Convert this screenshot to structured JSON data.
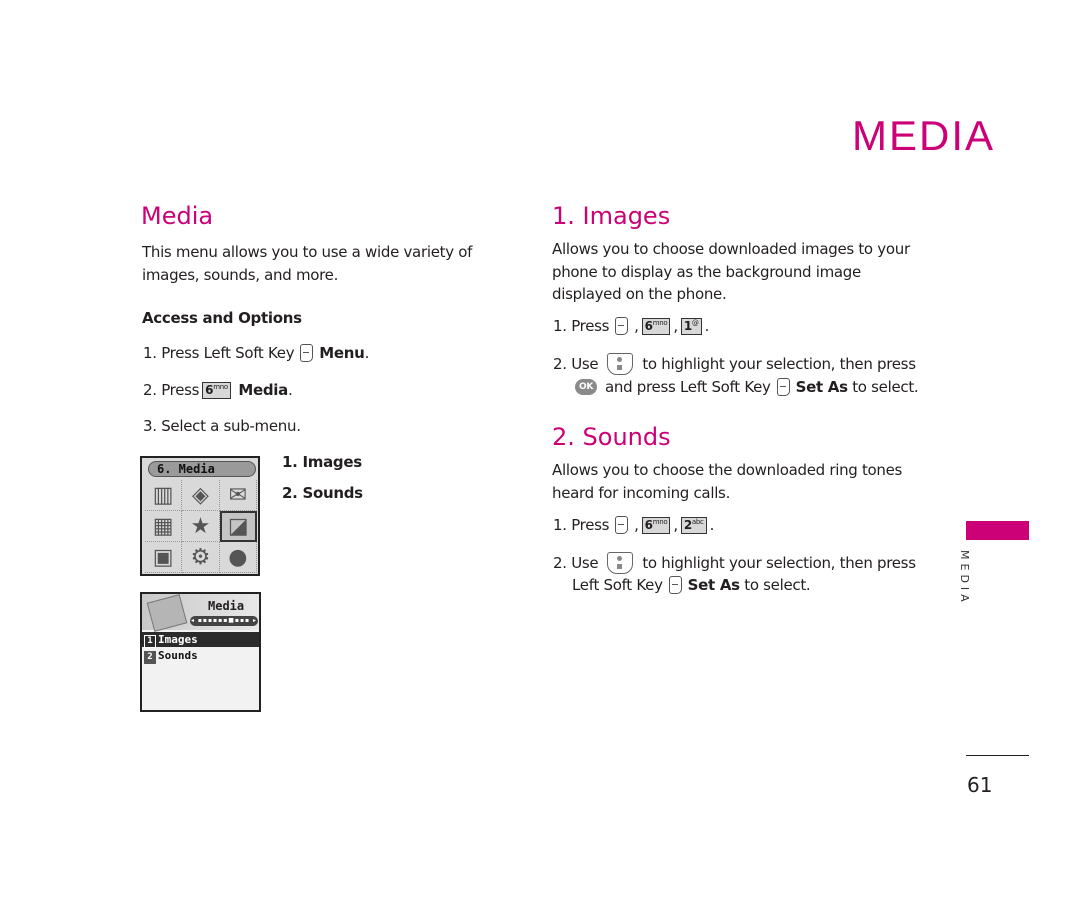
{
  "chapter_title": "MEDIA",
  "left": {
    "heading": "Media",
    "intro": "This menu allows you to use a wide variety of images, sounds, and more.",
    "subheading": "Access and Options",
    "steps": [
      {
        "num": "1.",
        "text": "Press Left Soft Key",
        "icon": "left-soft-key-icon",
        "bold": "Menu",
        "end": "."
      },
      {
        "num": "2.",
        "text": "Press",
        "icon": "key-6-mno",
        "bold": "Media",
        "end": "."
      },
      {
        "num": "3.",
        "text": "Select a sub-menu."
      }
    ],
    "submenu": [
      "1. Images",
      "2. Sounds"
    ],
    "phone_screen_1": {
      "title": "6. Media",
      "icons": [
        "address-book-icon",
        "calendar-icon",
        "messages-icon",
        "phone-icon",
        "star-icon",
        "media-icon",
        "toolbox-icon",
        "settings-gears-icon",
        "mouse-icon"
      ]
    },
    "phone_screen_2": {
      "title": "Media",
      "scroll_indicator": "◂ ▪▪▪▪▪▪■▪▪▪ ▸",
      "items": [
        {
          "num": "1",
          "label": "Images",
          "highlighted": true
        },
        {
          "num": "2",
          "label": "Sounds",
          "highlighted": false
        }
      ]
    }
  },
  "right": {
    "images": {
      "heading": "1. Images",
      "desc": "Allows you to choose downloaded images to your phone to display as the background image displayed on the phone.",
      "step1": {
        "num": "1.",
        "text": "Press",
        "keys": [
          "left-soft-key",
          "6mno",
          "1"
        ],
        "end": "."
      },
      "step2": {
        "num": "2.",
        "use": "Use",
        "after_nav": "to highlight your selection, then press",
        "ok": "OK",
        "line2a": "and press Left Soft Key",
        "bold": "Set As",
        "line2b": "to select."
      }
    },
    "sounds": {
      "heading": "2. Sounds",
      "desc": "Allows you to choose the downloaded ring tones heard for incoming calls.",
      "step1": {
        "num": "1.",
        "text": "Press",
        "keys": [
          "left-soft-key",
          "6mno",
          "2abc"
        ],
        "end": "."
      },
      "step2": {
        "num": "2.",
        "use": "Use",
        "after_nav": "to highlight your selection, then press",
        "line2a": "Left Soft Key",
        "bold": "Set As",
        "line2b": "to select."
      }
    }
  },
  "key_labels": {
    "six": "6",
    "six_sup": "mno",
    "one": "1",
    "one_sup": "@",
    "two": "2",
    "two_sup": "abc"
  },
  "side_tab_label": "MEDIA",
  "page_number": "61",
  "colors": {
    "accent": "#cc0077",
    "text": "#231f20"
  }
}
